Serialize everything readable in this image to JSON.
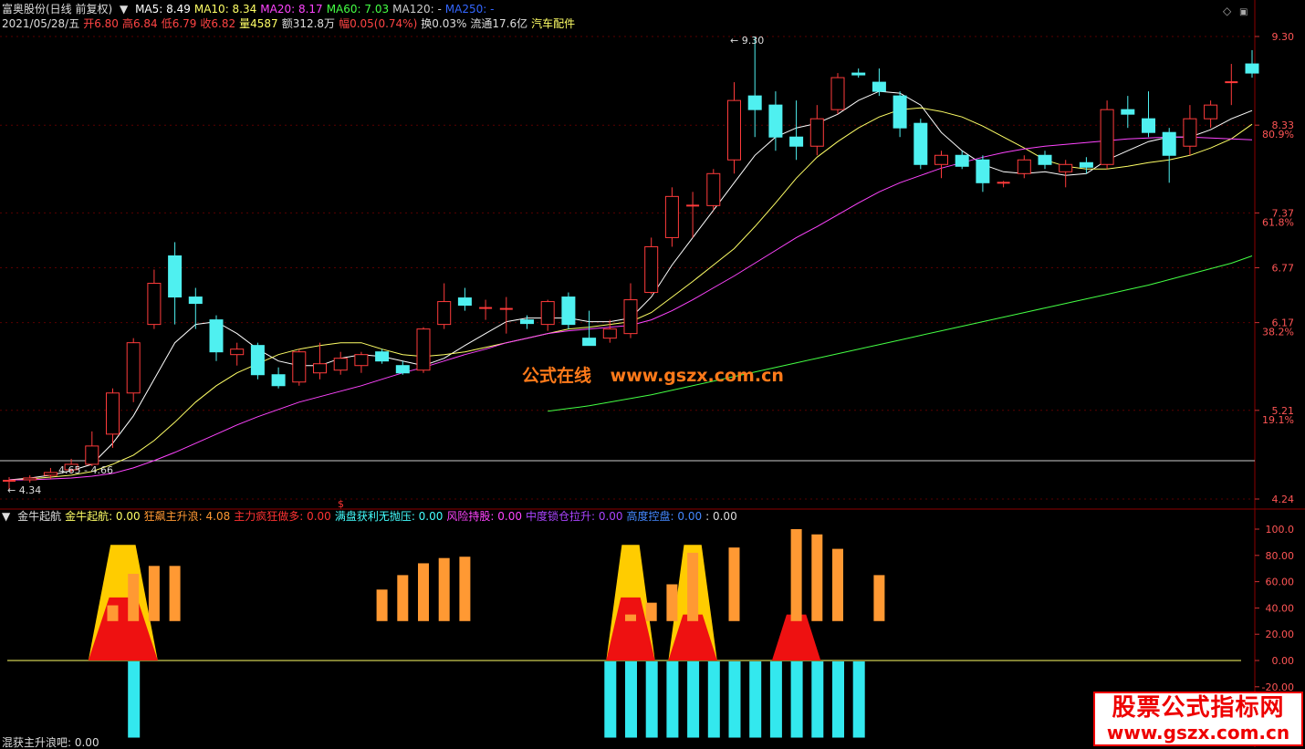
{
  "header": {
    "stock": "富奥股份(日线 前复权)",
    "ma": [
      {
        "label": "MA5: 8.49",
        "color": "#ffffff"
      },
      {
        "label": "MA10: 8.34",
        "color": "#ffff66"
      },
      {
        "label": "MA20: 8.17",
        "color": "#ff44ff"
      },
      {
        "label": "MA60: 7.03",
        "color": "#44ff44"
      },
      {
        "label": "MA120: -",
        "color": "#cccccc"
      },
      {
        "label": "MA250: -",
        "color": "#3366ff"
      }
    ],
    "line2": [
      {
        "text": "2021/05/28/五",
        "color": "#dddddd"
      },
      {
        "text": "开6.80",
        "color": "#ff4444"
      },
      {
        "text": "高6.84",
        "color": "#ff4444"
      },
      {
        "text": "低6.79",
        "color": "#ff4444"
      },
      {
        "text": "收6.82",
        "color": "#ff4444"
      },
      {
        "text": "量4587",
        "color": "#ffff66"
      },
      {
        "text": "额312.8万",
        "color": "#dddddd"
      },
      {
        "text": "幅0.05(0.74%)",
        "color": "#ff4444"
      },
      {
        "text": "换0.03%",
        "color": "#dddddd"
      },
      {
        "text": "流通17.6亿",
        "color": "#dddddd"
      },
      {
        "text": "汽车配件",
        "color": "#ffff66"
      }
    ]
  },
  "indicator_header": [
    {
      "text": "金牛起航",
      "color": "#dddddd"
    },
    {
      "text": "金牛起航: 0.00",
      "color": "#ffff66"
    },
    {
      "text": "狂飙主升浪: 4.08",
      "color": "#ff9933"
    },
    {
      "text": "主力疯狂做多: 0.00",
      "color": "#ff3333"
    },
    {
      "text": "满盘获利无抛压: 0.00",
      "color": "#44ffff"
    },
    {
      "text": "风险持股: 0.00",
      "color": "#ff44ff"
    },
    {
      "text": "中度锁仓拉升: 0.00",
      "color": "#aa44ff"
    },
    {
      "text": "高度控盘: 0.00",
      "color": "#4488ff"
    },
    {
      "text": ": 0.00",
      "color": "#dddddd"
    }
  ],
  "bottom_text": "混获主升浪吧: 0.00",
  "watermark_center": [
    "公式在线",
    "www.gszx.com.cn"
  ],
  "watermark_box": {
    "title": "股票公式指标网",
    "url": "www.gszx.com.cn"
  },
  "chart_data": [
    {
      "type": "candlestick",
      "price_axis": {
        "ticks": [
          "9.30",
          "8.33",
          "7.37",
          "6.77",
          "6.17",
          "5.21",
          "4.24"
        ],
        "ylim": [
          4.24,
          9.3
        ]
      },
      "fib_labels": [
        {
          "text": "80.9%",
          "value": 8.23
        },
        {
          "text": "61.8%",
          "value": 7.27
        },
        {
          "text": "38.2%",
          "value": 6.07
        },
        {
          "text": "19.1%",
          "value": 5.11
        }
      ],
      "annotations": [
        "9.30",
        "4.34",
        "4.65 - 4.66",
        "$"
      ],
      "candles": [
        {
          "o": 4.44,
          "h": 4.48,
          "l": 4.34,
          "c": 4.44,
          "t": "d"
        },
        {
          "o": 4.47,
          "h": 4.5,
          "l": 4.42,
          "c": 4.45,
          "t": "h"
        },
        {
          "o": 4.5,
          "h": 4.58,
          "l": 4.46,
          "c": 4.53,
          "t": "h"
        },
        {
          "o": 4.56,
          "h": 4.68,
          "l": 4.52,
          "c": 4.62,
          "t": "h"
        },
        {
          "o": 4.62,
          "h": 4.98,
          "l": 4.6,
          "c": 4.82,
          "t": "h"
        },
        {
          "o": 4.95,
          "h": 5.45,
          "l": 4.8,
          "c": 5.4,
          "t": "h"
        },
        {
          "o": 5.4,
          "h": 6.0,
          "l": 5.3,
          "c": 5.95,
          "t": "h"
        },
        {
          "o": 6.15,
          "h": 6.75,
          "l": 6.1,
          "c": 6.6,
          "t": "h"
        },
        {
          "o": 6.9,
          "h": 7.05,
          "l": 6.15,
          "c": 6.45,
          "t": "s"
        },
        {
          "o": 6.45,
          "h": 6.55,
          "l": 6.1,
          "c": 6.38,
          "t": "s"
        },
        {
          "o": 6.2,
          "h": 6.25,
          "l": 5.75,
          "c": 5.85,
          "t": "s"
        },
        {
          "o": 5.88,
          "h": 5.95,
          "l": 5.7,
          "c": 5.82,
          "t": "h"
        },
        {
          "o": 5.92,
          "h": 5.95,
          "l": 5.55,
          "c": 5.6,
          "t": "s"
        },
        {
          "o": 5.6,
          "h": 5.68,
          "l": 5.45,
          "c": 5.48,
          "t": "s"
        },
        {
          "o": 5.52,
          "h": 5.88,
          "l": 5.48,
          "c": 5.85,
          "t": "h"
        },
        {
          "o": 5.62,
          "h": 5.95,
          "l": 5.55,
          "c": 5.72,
          "t": "h"
        },
        {
          "o": 5.65,
          "h": 5.85,
          "l": 5.6,
          "c": 5.78,
          "t": "h"
        },
        {
          "o": 5.7,
          "h": 5.85,
          "l": 5.62,
          "c": 5.82,
          "t": "h"
        },
        {
          "o": 5.85,
          "h": 5.88,
          "l": 5.72,
          "c": 5.75,
          "t": "s"
        },
        {
          "o": 5.7,
          "h": 5.75,
          "l": 5.6,
          "c": 5.62,
          "t": "s"
        },
        {
          "o": 5.65,
          "h": 6.12,
          "l": 5.62,
          "c": 6.1,
          "t": "h"
        },
        {
          "o": 6.15,
          "h": 6.6,
          "l": 6.1,
          "c": 6.4,
          "t": "h"
        },
        {
          "o": 6.44,
          "h": 6.55,
          "l": 6.3,
          "c": 6.36,
          "t": "s"
        },
        {
          "o": 6.33,
          "h": 6.42,
          "l": 6.2,
          "c": 6.31,
          "t": "d"
        },
        {
          "o": 6.32,
          "h": 6.45,
          "l": 6.05,
          "c": 6.3,
          "t": "d"
        },
        {
          "o": 6.2,
          "h": 6.25,
          "l": 6.1,
          "c": 6.16,
          "t": "s"
        },
        {
          "o": 6.15,
          "h": 6.42,
          "l": 6.08,
          "c": 6.4,
          "t": "h"
        },
        {
          "o": 6.45,
          "h": 6.5,
          "l": 6.1,
          "c": 6.15,
          "t": "s"
        },
        {
          "o": 6.0,
          "h": 6.3,
          "l": 5.92,
          "c": 5.92,
          "t": "s"
        },
        {
          "o": 6.0,
          "h": 6.2,
          "l": 5.95,
          "c": 6.1,
          "t": "h"
        },
        {
          "o": 6.05,
          "h": 6.6,
          "l": 6.0,
          "c": 6.42,
          "t": "h"
        },
        {
          "o": 6.5,
          "h": 7.1,
          "l": 6.48,
          "c": 7.0,
          "t": "h"
        },
        {
          "o": 7.1,
          "h": 7.65,
          "l": 7.0,
          "c": 7.55,
          "t": "h"
        },
        {
          "o": 7.45,
          "h": 7.6,
          "l": 7.1,
          "c": 7.45,
          "t": "d"
        },
        {
          "o": 7.45,
          "h": 7.85,
          "l": 7.4,
          "c": 7.8,
          "t": "h"
        },
        {
          "o": 7.95,
          "h": 8.8,
          "l": 7.8,
          "c": 8.6,
          "t": "h"
        },
        {
          "o": 8.65,
          "h": 9.3,
          "l": 8.2,
          "c": 8.5,
          "t": "s"
        },
        {
          "o": 8.55,
          "h": 8.7,
          "l": 8.05,
          "c": 8.2,
          "t": "s"
        },
        {
          "o": 8.2,
          "h": 8.6,
          "l": 7.95,
          "c": 8.1,
          "t": "s"
        },
        {
          "o": 8.1,
          "h": 8.55,
          "l": 8.0,
          "c": 8.4,
          "t": "h"
        },
        {
          "o": 8.5,
          "h": 8.9,
          "l": 8.45,
          "c": 8.85,
          "t": "h"
        },
        {
          "o": 8.9,
          "h": 8.95,
          "l": 8.85,
          "c": 8.88,
          "t": "s"
        },
        {
          "o": 8.8,
          "h": 8.95,
          "l": 8.65,
          "c": 8.7,
          "t": "s"
        },
        {
          "o": 8.65,
          "h": 8.7,
          "l": 8.2,
          "c": 8.3,
          "t": "s"
        },
        {
          "o": 8.35,
          "h": 8.4,
          "l": 7.85,
          "c": 7.9,
          "t": "s"
        },
        {
          "o": 7.9,
          "h": 8.05,
          "l": 7.75,
          "c": 8.0,
          "t": "h"
        },
        {
          "o": 8.0,
          "h": 8.05,
          "l": 7.85,
          "c": 7.88,
          "t": "s"
        },
        {
          "o": 7.95,
          "h": 8.0,
          "l": 7.6,
          "c": 7.7,
          "t": "s"
        },
        {
          "o": 7.7,
          "h": 7.72,
          "l": 7.65,
          "c": 7.7,
          "t": "d"
        },
        {
          "o": 7.8,
          "h": 8.0,
          "l": 7.75,
          "c": 7.95,
          "t": "h"
        },
        {
          "o": 8.0,
          "h": 8.05,
          "l": 7.85,
          "c": 7.9,
          "t": "s"
        },
        {
          "o": 7.82,
          "h": 7.95,
          "l": 7.65,
          "c": 7.9,
          "t": "h"
        },
        {
          "o": 7.92,
          "h": 7.98,
          "l": 7.8,
          "c": 7.87,
          "t": "s"
        },
        {
          "o": 7.9,
          "h": 8.6,
          "l": 7.85,
          "c": 8.5,
          "t": "h"
        },
        {
          "o": 8.5,
          "h": 8.65,
          "l": 8.3,
          "c": 8.45,
          "t": "s"
        },
        {
          "o": 8.4,
          "h": 8.7,
          "l": 8.2,
          "c": 8.25,
          "t": "s"
        },
        {
          "o": 8.25,
          "h": 8.3,
          "l": 7.7,
          "c": 8.0,
          "t": "s"
        },
        {
          "o": 8.1,
          "h": 8.55,
          "l": 8.0,
          "c": 8.4,
          "t": "h"
        },
        {
          "o": 8.4,
          "h": 8.6,
          "l": 8.3,
          "c": 8.55,
          "t": "h"
        },
        {
          "o": 8.8,
          "h": 9.0,
          "l": 8.55,
          "c": 8.8,
          "t": "d"
        },
        {
          "o": 9.0,
          "h": 9.15,
          "l": 8.85,
          "c": 8.9,
          "t": "s"
        }
      ],
      "series": [
        {
          "name": "MA5",
          "color": "#ffffff",
          "x_start": 0,
          "values": [
            4.45,
            4.47,
            4.5,
            4.55,
            4.62,
            4.85,
            5.15,
            5.55,
            5.95,
            6.15,
            6.18,
            6.05,
            5.88,
            5.75,
            5.7,
            5.7,
            5.78,
            5.82,
            5.8,
            5.75,
            5.7,
            5.78,
            5.92,
            6.05,
            6.18,
            6.22,
            6.22,
            6.22,
            6.18,
            6.18,
            6.22,
            6.45,
            6.8,
            7.1,
            7.4,
            7.7,
            8.0,
            8.2,
            8.3,
            8.35,
            8.45,
            8.6,
            8.7,
            8.68,
            8.55,
            8.25,
            8.05,
            7.9,
            7.82,
            7.8,
            7.82,
            7.78,
            7.8,
            7.95,
            8.05,
            8.15,
            8.2,
            8.2,
            8.28,
            8.4,
            8.49
          ]
        },
        {
          "name": "MA10",
          "color": "#ffff66",
          "x_start": 0,
          "values": [
            4.45,
            4.46,
            4.48,
            4.5,
            4.54,
            4.62,
            4.72,
            4.88,
            5.08,
            5.3,
            5.48,
            5.62,
            5.72,
            5.82,
            5.88,
            5.92,
            5.95,
            5.95,
            5.88,
            5.82,
            5.8,
            5.82,
            5.85,
            5.9,
            5.95,
            6.0,
            6.05,
            6.1,
            6.12,
            6.15,
            6.18,
            6.28,
            6.45,
            6.62,
            6.8,
            6.98,
            7.22,
            7.48,
            7.75,
            7.98,
            8.15,
            8.3,
            8.42,
            8.5,
            8.52,
            8.48,
            8.42,
            8.32,
            8.2,
            8.08,
            7.95,
            7.88,
            7.85,
            7.85,
            7.88,
            7.92,
            7.95,
            8.0,
            8.08,
            8.18,
            8.34
          ]
        },
        {
          "name": "MA20",
          "color": "#ff44ff",
          "x_start": 0,
          "values": [
            4.45,
            4.45,
            4.46,
            4.47,
            4.49,
            4.52,
            4.58,
            4.66,
            4.75,
            4.85,
            4.95,
            5.05,
            5.14,
            5.22,
            5.3,
            5.36,
            5.42,
            5.48,
            5.55,
            5.62,
            5.68,
            5.75,
            5.82,
            5.88,
            5.95,
            6.0,
            6.05,
            6.08,
            6.1,
            6.12,
            6.14,
            6.2,
            6.3,
            6.42,
            6.55,
            6.68,
            6.82,
            6.96,
            7.1,
            7.22,
            7.35,
            7.48,
            7.6,
            7.7,
            7.78,
            7.86,
            7.92,
            7.98,
            8.03,
            8.07,
            8.1,
            8.12,
            8.14,
            8.16,
            8.18,
            8.19,
            8.2,
            8.2,
            8.19,
            8.18,
            8.17
          ]
        },
        {
          "name": "MA60",
          "color": "#44ff44",
          "x_start": 26,
          "values": [
            5.2,
            5.23,
            5.26,
            5.3,
            5.34,
            5.38,
            5.43,
            5.48,
            5.53,
            5.58,
            5.63,
            5.68,
            5.73,
            5.78,
            5.83,
            5.88,
            5.93,
            5.98,
            6.03,
            6.08,
            6.13,
            6.18,
            6.23,
            6.28,
            6.33,
            6.38,
            6.43,
            6.48,
            6.53,
            6.58,
            6.64,
            6.7,
            6.76,
            6.82,
            6.9
          ]
        }
      ]
    },
    {
      "type": "bar",
      "name": "金牛起航",
      "yaxis": {
        "ticks": [
          "100.0",
          "80.00",
          "60.00",
          "40.00",
          "20.00",
          "0.00",
          "-20.00"
        ],
        "ylim": [
          -20,
          100
        ]
      },
      "yellow_trapezoids": [
        {
          "x0": 4,
          "x1": 7,
          "top": 88
        },
        {
          "x0": 29,
          "x1": 31,
          "top": 88
        },
        {
          "x0": 32,
          "x1": 34,
          "top": 88
        }
      ],
      "red_trapezoids": [
        {
          "x0": 4,
          "x1": 7,
          "top": 48
        },
        {
          "x0": 29,
          "x1": 31,
          "top": 48
        },
        {
          "x0": 32,
          "x1": 34,
          "top": 35
        },
        {
          "x0": 37,
          "x1": 39,
          "top": 35
        }
      ],
      "orange_bars": [
        {
          "x": 5,
          "from": 30,
          "to": 42
        },
        {
          "x": 6,
          "from": 30,
          "to": 66
        },
        {
          "x": 7,
          "from": 30,
          "to": 72
        },
        {
          "x": 8,
          "from": 30,
          "to": 72
        },
        {
          "x": 18,
          "from": 30,
          "to": 54
        },
        {
          "x": 19,
          "from": 30,
          "to": 65
        },
        {
          "x": 20,
          "from": 30,
          "to": 74
        },
        {
          "x": 21,
          "from": 30,
          "to": 78
        },
        {
          "x": 22,
          "from": 30,
          "to": 79
        },
        {
          "x": 30,
          "from": 30,
          "to": 35
        },
        {
          "x": 31,
          "from": 30,
          "to": 44
        },
        {
          "x": 32,
          "from": 30,
          "to": 58
        },
        {
          "x": 33,
          "from": 30,
          "to": 82
        },
        {
          "x": 35,
          "from": 30,
          "to": 86
        },
        {
          "x": 38,
          "from": 30,
          "to": 100
        },
        {
          "x": 39,
          "from": 30,
          "to": 96
        },
        {
          "x": 40,
          "from": 30,
          "to": 85
        },
        {
          "x": 42,
          "from": 30,
          "to": 65
        }
      ],
      "cyan_bars": [
        6,
        29,
        30,
        31,
        32,
        33,
        34,
        35,
        36,
        37,
        38,
        39,
        40,
        41
      ],
      "cyan_depth": -58
    }
  ]
}
